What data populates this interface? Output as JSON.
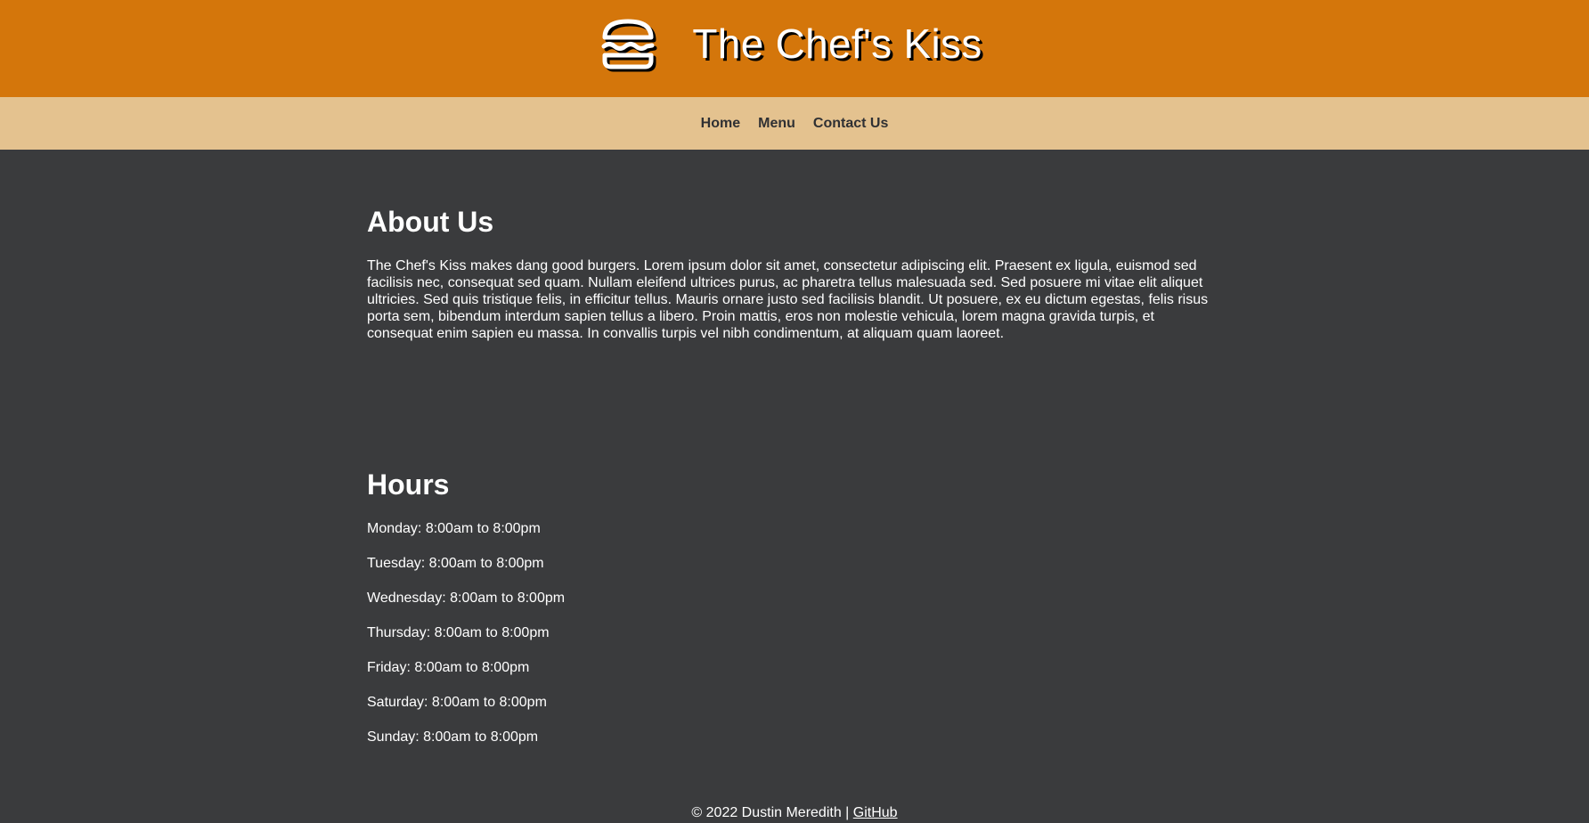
{
  "header": {
    "title": "The Chef's Kiss",
    "logo_icon": "burger-icon"
  },
  "nav": {
    "items": [
      {
        "label": "Home"
      },
      {
        "label": "Menu"
      },
      {
        "label": "Contact Us"
      }
    ]
  },
  "about": {
    "heading": "About Us",
    "text": "The Chef's Kiss makes dang good burgers. Lorem ipsum dolor sit amet, consectetur adipiscing elit. Praesent ex ligula, euismod sed facilisis nec, consequat sed quam. Nullam eleifend ultrices purus, ac pharetra tellus malesuada sed. Sed posuere mi vitae elit aliquet ultricies. Sed quis tristique felis, in efficitur tellus. Mauris ornare justo sed facilisis blandit. Ut posuere, ex eu dictum egestas, felis risus porta sem, bibendum interdum sapien tellus a libero. Proin mattis, eros non molestie vehicula, lorem magna gravida turpis, et consequat enim sapien eu massa. In convallis turpis vel nibh condimentum, at aliquam quam laoreet."
  },
  "hours": {
    "heading": "Hours",
    "items": [
      "Monday: 8:00am to 8:00pm",
      "Tuesday: 8:00am to 8:00pm",
      "Wednesday: 8:00am to 8:00pm",
      "Thursday: 8:00am to 8:00pm",
      "Friday: 8:00am to 8:00pm",
      "Saturday: 8:00am to 8:00pm",
      "Sunday: 8:00am to 8:00pm"
    ]
  },
  "footer": {
    "copyright": "© 2022 Dustin Meredith | ",
    "github_label": "GitHub"
  },
  "colors": {
    "header_bg": "#d4760b",
    "nav_bg": "#e4c28f",
    "page_bg": "#3a3b3d",
    "nav_text": "#2f3033"
  }
}
